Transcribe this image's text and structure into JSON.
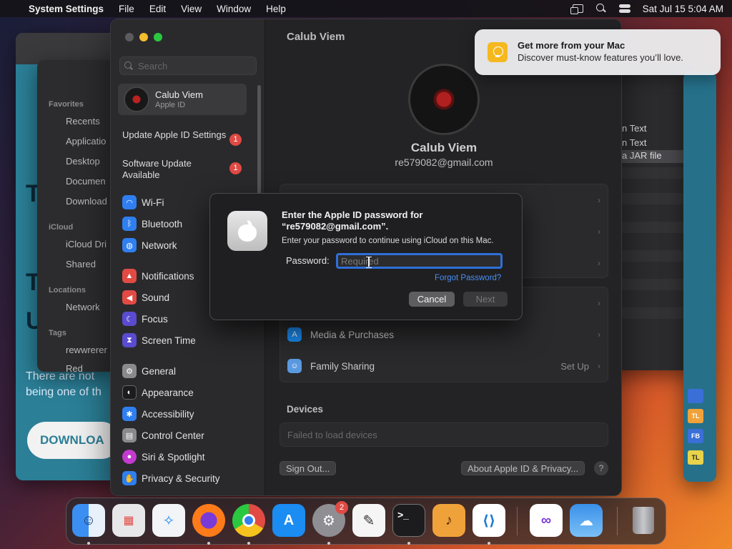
{
  "menubar": {
    "app_name": "System Settings",
    "menus": [
      "File",
      "Edit",
      "View",
      "Window",
      "Help"
    ],
    "datetime": "Sat Jul 15  5:04 AM"
  },
  "background_web": {
    "letters": [
      "T",
      "T",
      "U"
    ],
    "teaser_line1": "There are not",
    "teaser_line2": "being one of th",
    "download_label": "DOWNLOA"
  },
  "background_finder": {
    "favorites_label": "Favorites",
    "favorites": [
      "Recents",
      "Applicatio",
      "Desktop",
      "Documen",
      "Download"
    ],
    "icloud_label": "iCloud",
    "icloud_items": [
      "iCloud Dri",
      "Shared"
    ],
    "locations_label": "Locations",
    "locations": [
      "Network"
    ],
    "tags_label": "Tags",
    "tags": [
      "rewwrerer",
      "Red"
    ]
  },
  "background_right": {
    "rows": [
      "n Text",
      "n Text",
      "a JAR file"
    ],
    "tiles": [
      "TL",
      "FB",
      "TL"
    ]
  },
  "sidebar": {
    "search_placeholder": "Search",
    "account_name": "Calub Viem",
    "account_sub": "Apple ID",
    "notice1": "Update Apple ID Settings",
    "notice1_badge": "1",
    "notice2": "Software Update Available",
    "notice2_badge": "1",
    "items": [
      {
        "label": "Wi-Fi",
        "icon": "wifi-icon",
        "color": "#2f7ff0"
      },
      {
        "label": "Bluetooth",
        "icon": "bluetooth-icon",
        "color": "#2f7ff0"
      },
      {
        "label": "Network",
        "icon": "globe-icon",
        "color": "#2f7ff0"
      },
      {
        "label": "Notifications",
        "icon": "bell-icon",
        "color": "#e24a44"
      },
      {
        "label": "Sound",
        "icon": "speaker-icon",
        "color": "#e24a44"
      },
      {
        "label": "Focus",
        "icon": "moon-icon",
        "color": "#5a4bd0"
      },
      {
        "label": "Screen Time",
        "icon": "hourglass-icon",
        "color": "#5a4bd0"
      },
      {
        "label": "General",
        "icon": "gear-icon",
        "color": "#8a8a8e"
      },
      {
        "label": "Appearance",
        "icon": "appearance-icon",
        "color": "#1c1c1e"
      },
      {
        "label": "Accessibility",
        "icon": "accessibility-icon",
        "color": "#2f7ff0"
      },
      {
        "label": "Control Center",
        "icon": "control-center-icon",
        "color": "#8a8a8e"
      },
      {
        "label": "Siri & Spotlight",
        "icon": "siri-icon",
        "color": "#c23ad0"
      },
      {
        "label": "Privacy & Security",
        "icon": "hand-icon",
        "color": "#2f7ff0"
      }
    ]
  },
  "content": {
    "title": "Calub Viem",
    "name": "Calub Viem",
    "email": "re579082@gmail.com",
    "media_purchases": "Media & Purchases",
    "family_sharing": "Family Sharing",
    "family_sharing_value": "Set Up",
    "devices_label": "Devices",
    "devices_status": "Failed to load devices",
    "sign_out": "Sign Out...",
    "about": "About Apple ID & Privacy...",
    "help": "?"
  },
  "dialog": {
    "title": "Enter the Apple ID password for “re579082@gmail.com”.",
    "subtitle": "Enter your password to continue using iCloud on this Mac.",
    "password_label": "Password:",
    "password_placeholder": "Required",
    "forgot": "Forgot Password?",
    "cancel": "Cancel",
    "next": "Next"
  },
  "notification": {
    "title": "Get more from your Mac",
    "body": "Discover must-know features you’ll love."
  },
  "dock": {
    "apps": [
      {
        "name": "finder-icon",
        "color": "#3b8ff2"
      },
      {
        "name": "launchpad-icon",
        "color": "#e7e7ea"
      },
      {
        "name": "safari-icon",
        "color": "#f2f4f7"
      },
      {
        "name": "firefox-icon",
        "color": "#ff7b1a"
      },
      {
        "name": "chrome-icon",
        "color": "#ffffff"
      },
      {
        "name": "app-store-icon",
        "color": "#1a8cf2"
      },
      {
        "name": "system-settings-icon",
        "color": "#8e8e93"
      },
      {
        "name": "textedit-icon",
        "color": "#f5f5f5"
      },
      {
        "name": "terminal-icon",
        "color": "#1c1c1e"
      },
      {
        "name": "garageband-icon",
        "color": "#f0a23a"
      },
      {
        "name": "vscode-icon",
        "color": "#ffffff"
      },
      {
        "name": "visual-studio-icon",
        "color": "#ffffff"
      },
      {
        "name": "weather-icon",
        "color": "#3a90e8"
      },
      {
        "name": "trash-icon",
        "color": "#7a7a7e"
      }
    ],
    "settings_badge": "2",
    "terminal_glyph": ">_"
  }
}
